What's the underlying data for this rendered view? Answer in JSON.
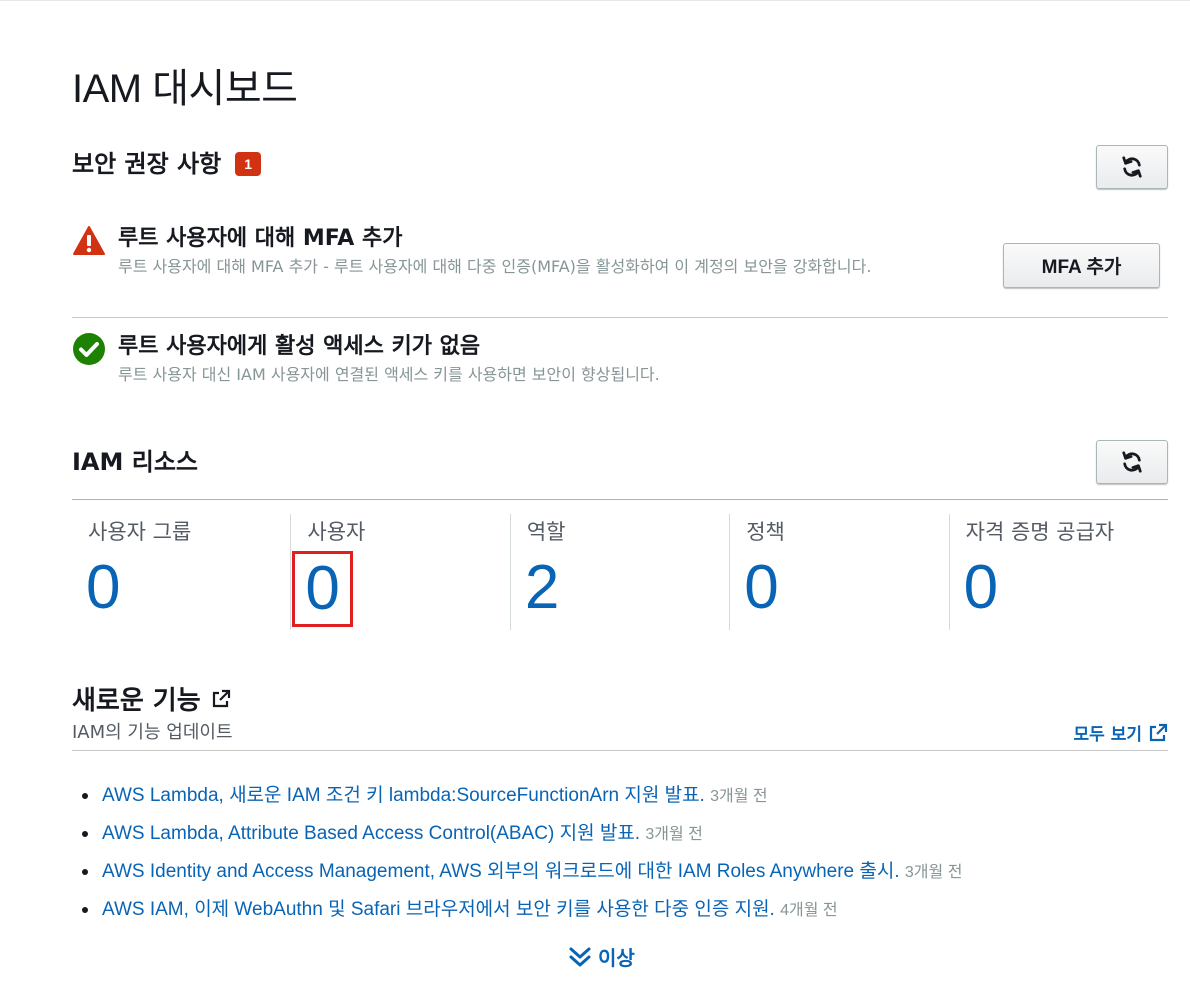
{
  "page": {
    "title": "IAM 대시보드"
  },
  "security": {
    "title": "보안 권장 사항",
    "badge_count": "1",
    "recommendations": [
      {
        "status": "warning",
        "icon": "warning-triangle-icon",
        "title": "루트 사용자에 대해 MFA 추가",
        "description": "루트 사용자에 대해 MFA 추가 - 루트 사용자에 대해 다중 인증(MFA)을 활성화하여 이 계정의 보안을 강화합니다.",
        "button_label": "MFA 추가"
      },
      {
        "status": "ok",
        "icon": "check-circle-icon",
        "title": "루트 사용자에게 활성 액세스 키가 없음",
        "description": "루트 사용자 대신 IAM 사용자에 연결된 액세스 키를 사용하면 보안이 향상됩니다."
      }
    ]
  },
  "resources": {
    "title": "IAM 리소스",
    "items": [
      {
        "label": "사용자 그룹",
        "value": "0"
      },
      {
        "label": "사용자",
        "value": "0"
      },
      {
        "label": "역할",
        "value": "2"
      },
      {
        "label": "정책",
        "value": "0"
      },
      {
        "label": "자격 증명 공급자",
        "value": "0"
      }
    ]
  },
  "whats_new": {
    "title": "새로운 기능",
    "subtitle": "IAM의 기능 업데이트",
    "view_all_label": "모두 보기",
    "items": [
      {
        "text": "AWS Lambda, 새로운 IAM 조건 키 lambda:SourceFunctionArn 지원 발표.",
        "ago": "3개월 전"
      },
      {
        "text": "AWS Lambda, Attribute Based Access Control(ABAC) 지원 발표.",
        "ago": "3개월 전"
      },
      {
        "text": "AWS Identity and Access Management, AWS 외부의 워크로드에 대한 IAM Roles Anywhere 출시.",
        "ago": "3개월 전"
      },
      {
        "text": "AWS IAM, 이제 WebAuthn 및 Safari 브라우저에서 보안 키를 사용한 다중 인증 지원.",
        "ago": "4개월 전"
      }
    ],
    "more_label": "이상"
  },
  "colors": {
    "link": "#0a64b5",
    "badge": "#d13212",
    "warning": "#d13212",
    "success": "#1d8102",
    "highlight": "#e02020"
  }
}
